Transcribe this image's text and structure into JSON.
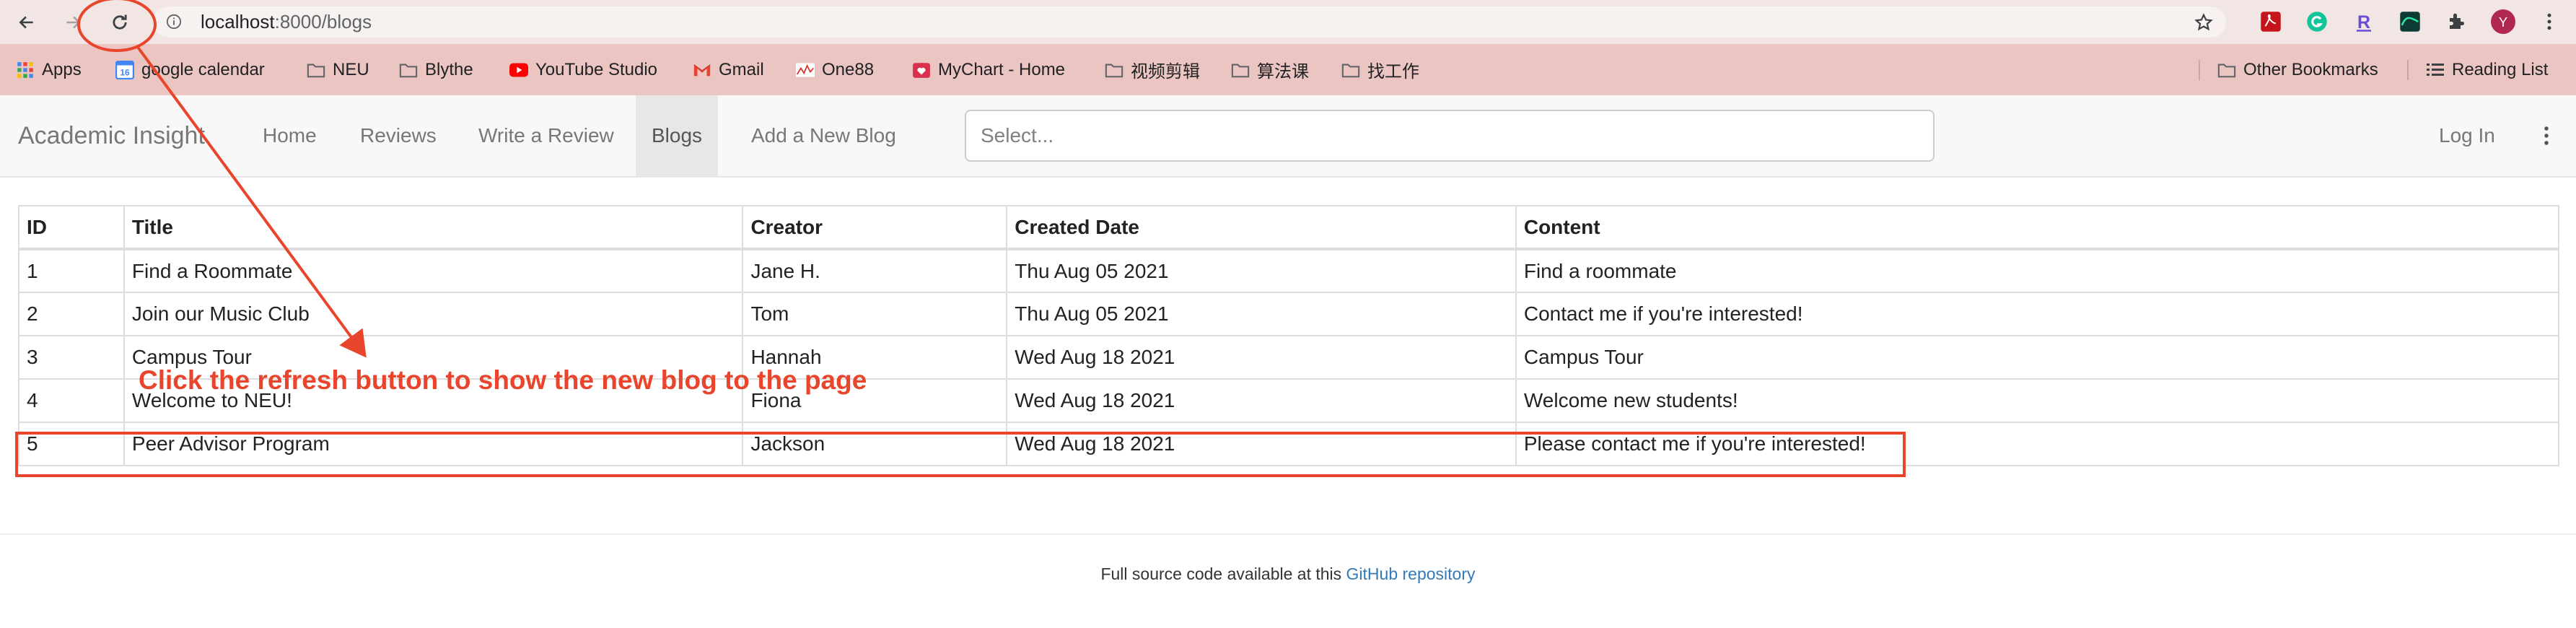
{
  "browser": {
    "url_host": "localhost",
    "url_path": ":8000/blogs",
    "bookmarks": [
      {
        "label": "Apps",
        "icon": "apps-grid-icon"
      },
      {
        "label": "google calendar",
        "icon": "google-calendar-icon"
      },
      {
        "label": "NEU",
        "icon": "folder-icon"
      },
      {
        "label": "Blythe",
        "icon": "folder-icon"
      },
      {
        "label": "YouTube Studio",
        "icon": "youtube-icon"
      },
      {
        "label": "Gmail",
        "icon": "gmail-icon"
      },
      {
        "label": "One88",
        "icon": "chart-line-icon"
      },
      {
        "label": "MyChart - Home",
        "icon": "mychart-icon"
      },
      {
        "label": "视频剪辑",
        "icon": "folder-icon"
      },
      {
        "label": "算法课",
        "icon": "folder-icon"
      },
      {
        "label": "找工作",
        "icon": "folder-icon"
      }
    ],
    "other_bookmarks": "Other Bookmarks",
    "reading_list": "Reading List",
    "profile_initial": "Y",
    "colors": {
      "toolbar": "#f1e6e4",
      "bookmarks_bar": "#ebc5c1",
      "profile": "#b0284f"
    }
  },
  "navbar": {
    "brand": "Academic Insight",
    "links": [
      "Home",
      "Reviews",
      "Write a Review",
      "Blogs",
      "Add a New Blog"
    ],
    "active": "Blogs",
    "select_placeholder": "Select...",
    "login": "Log In"
  },
  "table": {
    "headers": [
      "ID",
      "Title",
      "Creator",
      "Created Date",
      "Content"
    ],
    "rows": [
      [
        "1",
        "Find a Roommate",
        "Jane H.",
        "Thu Aug 05 2021",
        "Find a roommate"
      ],
      [
        "2",
        "Join our Music Club",
        "Tom",
        "Thu Aug 05 2021",
        "Contact me if you're interested!"
      ],
      [
        "3",
        "Campus Tour",
        "Hannah",
        "Wed Aug 18 2021",
        "Campus Tour"
      ],
      [
        "4",
        "Welcome to NEU!",
        "Fiona",
        "Wed Aug 18 2021",
        "Welcome new students!"
      ],
      [
        "5",
        "Peer Advisor Program",
        "Jackson",
        "Wed Aug 18 2021",
        "Please contact me if you're interested!"
      ]
    ]
  },
  "footer": {
    "text": "Full source code available at this ",
    "link": "GitHub repository"
  },
  "annotation": {
    "text": "Click the refresh button to show the new blog to the page",
    "color": "#e8452c"
  }
}
